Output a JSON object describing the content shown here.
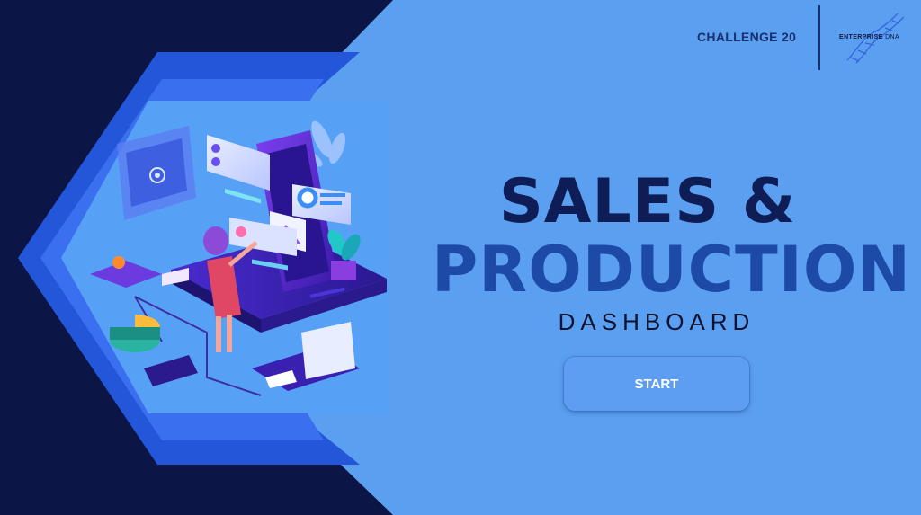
{
  "header": {
    "challenge_label": "CHALLENGE 20",
    "logo": {
      "name": "enterprise-dna-logo",
      "word1": "ENTERPRISE",
      "word2": "DNA"
    }
  },
  "hero": {
    "title_line1": "SALES &",
    "title_line2": "PRODUCTION",
    "subtitle": "DASHBOARD"
  },
  "actions": {
    "start_label": "START"
  },
  "colors": {
    "page_background": "#5b9ff0",
    "navy": "#0b1646",
    "title_dark": "#0f1d57",
    "title_blue": "#1c4aa6",
    "button_text": "#ffffff"
  },
  "illustration": {
    "name": "isometric-digital-marketing-illustration"
  }
}
